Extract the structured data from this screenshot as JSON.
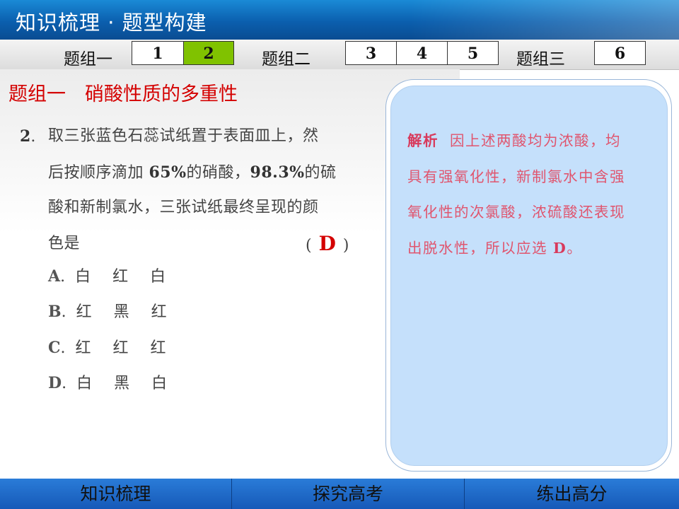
{
  "header": {
    "title": "知识梳理 · 题型构建"
  },
  "nav": {
    "group1_label": "题组一",
    "group2_label": "题组二",
    "group3_label": "题组三",
    "items": [
      "1",
      "2",
      "3",
      "4",
      "5",
      "6"
    ],
    "active_item": "2",
    "active_color": "#80c200"
  },
  "section": {
    "heading": "题组一　硝酸性质的多重性"
  },
  "question": {
    "number": "2",
    "dot": ".",
    "line1": "取三张蓝色石蕊试纸置于表面皿上，然",
    "line2_a": "后按顺序滴加 ",
    "line2_b": "65%",
    "line2_c": "的硝酸，",
    "line2_d": "98.3%",
    "line2_e": "的硫",
    "line3": "酸和新制氯水，三张试纸最终呈现的颜",
    "line4": "色是",
    "paren_open": "(",
    "answer": "D",
    "paren_close": ")",
    "options": [
      {
        "letter": "A",
        "dot": ".",
        "text": "白 红 白"
      },
      {
        "letter": "B",
        "dot": ".",
        "text": "红 黑 红"
      },
      {
        "letter": "C",
        "dot": ".",
        "text": "红 红 红"
      },
      {
        "letter": "D",
        "dot": ".",
        "text": "白 黑 白"
      }
    ]
  },
  "analysis": {
    "label": "解析",
    "line1": "因上述两酸均为浓酸，均",
    "line2": "具有强氧化性，新制氯水中含强",
    "line3": "氧化性的次氯酸，浓硫酸还表现",
    "line4_a": "出脱水性，所以应选 ",
    "line4_b": "D",
    "line4_c": "。"
  },
  "footer": {
    "tabs": [
      "知识梳理",
      "探究高考",
      "练出高分"
    ]
  },
  "colors": {
    "heading_red": "#d40000",
    "answer_red": "#d40000",
    "analysis_pink": "#e0556e",
    "panel_blue": "#c5e0fb",
    "bar_blue": "#0b5fae"
  }
}
